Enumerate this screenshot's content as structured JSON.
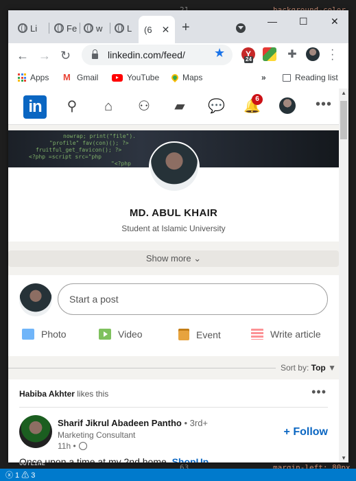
{
  "browser": {
    "tabs": [
      {
        "label": "Li"
      },
      {
        "label": "Fe"
      },
      {
        "label": "w"
      },
      {
        "label": "L"
      },
      {
        "label": "(6"
      }
    ],
    "url": "linkedin.com/feed/",
    "extension_badge": "24",
    "bookmarks": {
      "apps": "Apps",
      "gmail": "Gmail",
      "youtube": "YouTube",
      "maps": "Maps",
      "overflow": "»",
      "reading_list": "Reading list"
    }
  },
  "editor": {
    "line_top": "21",
    "code_top": "background-color",
    "line_bottom": "63",
    "code_bottom": "margin-left: 80px",
    "outline": "OUTLINE",
    "status": "ⓧ 1 ⚠ 3"
  },
  "linkedin": {
    "logo": "in",
    "notification_count": "6",
    "profile": {
      "name": "MD. ABUL KHAIR",
      "headline": "Student at Islamic University",
      "show_more": "Show more"
    },
    "composer": {
      "placeholder": "Start a post",
      "actions": {
        "photo": "Photo",
        "video": "Video",
        "event": "Event",
        "article": "Write article"
      }
    },
    "sort": {
      "label": "Sort by:",
      "value": "Top"
    },
    "feed_item": {
      "liker": "Habiba Akhter",
      "likes_text": "likes this",
      "author": "Sharif Jikrul Abadeen Pantho",
      "degree": "• 3rd+",
      "subtitle": "Marketing Consultant",
      "time": "11h •",
      "follow": "+ Follow",
      "text": "Once upon a time at my 2nd home,",
      "link": "ShopUp"
    }
  }
}
